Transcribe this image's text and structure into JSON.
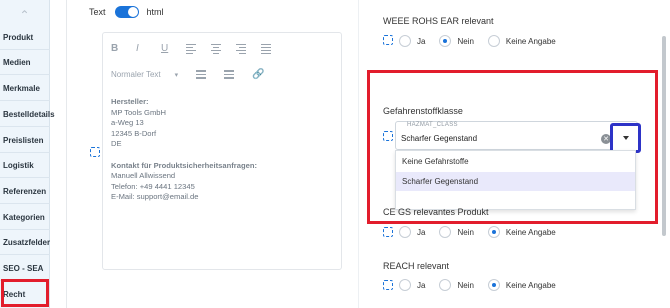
{
  "sidebar": {
    "items": [
      {
        "label": "Produkt"
      },
      {
        "label": "Medien"
      },
      {
        "label": "Merkmale"
      },
      {
        "label": "Bestelldetails"
      },
      {
        "label": "Preislisten"
      },
      {
        "label": "Logistik"
      },
      {
        "label": "Referenzen"
      },
      {
        "label": "Kategorien"
      },
      {
        "label": "Zusatzfelder"
      },
      {
        "label": "SEO - SEA"
      },
      {
        "label": "Recht"
      }
    ]
  },
  "editor_mode": {
    "text_label": "Text",
    "html_label": "html"
  },
  "editor": {
    "style_select": "Normaler Text",
    "content": {
      "manufacturer_heading": "Hersteller:",
      "manufacturer_lines": [
        "MP Tools GmbH",
        "a-Weg 13",
        "12345 B-Dorf",
        "DE"
      ],
      "contact_heading": "Kontakt für Produktsicherheitsanfragen:",
      "contact_lines": [
        "Manuell Allwissend",
        "Telefon: +49 4441 12345",
        "E-Mail: support@email.de"
      ]
    }
  },
  "fields": {
    "weee": {
      "title": "WEEE ROHS EAR relevant",
      "options": [
        "Ja",
        "Nein",
        "Keine Angabe"
      ],
      "selected": "Nein"
    },
    "hazard": {
      "title": "Gefahrenstoffklasse",
      "code": "HAZMAT_CLASS",
      "value": "Scharfer Gegenstand",
      "options": [
        "Keine Gefahrstoffe",
        "Scharfer Gegenstand"
      ]
    },
    "ce": {
      "title": "CE GS relevantes Produkt",
      "options": [
        "Ja",
        "Nein",
        "Keine Angabe"
      ],
      "selected": "Keine Angabe"
    },
    "reach": {
      "title": "REACH relevant",
      "options": [
        "Ja",
        "Nein",
        "Keine Angabe"
      ],
      "selected": "Keine Angabe"
    }
  },
  "colors": {
    "accent": "#1a73d9",
    "highlight_red": "#e21d2c",
    "highlight_blue": "#2d33c7"
  }
}
